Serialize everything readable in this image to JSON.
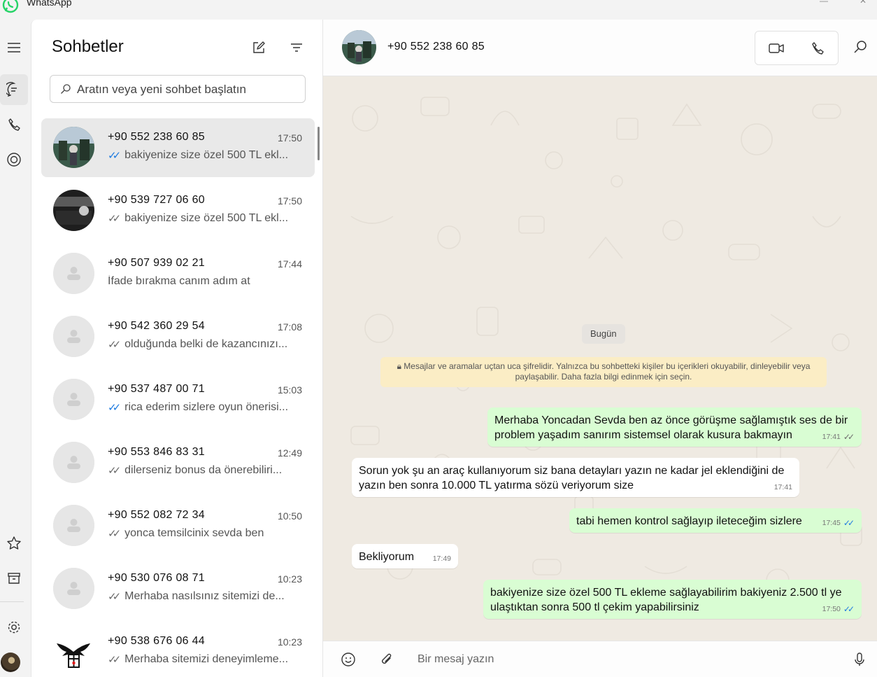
{
  "window": {
    "title": "WhatsApp"
  },
  "rail": {
    "items": [
      {
        "icon": "menu-icon"
      },
      {
        "icon": "chats-icon",
        "active": true
      },
      {
        "icon": "calls-icon"
      },
      {
        "icon": "status-icon"
      },
      {
        "icon": "star-icon"
      },
      {
        "icon": "archive-icon"
      },
      {
        "icon": "settings-icon"
      }
    ]
  },
  "chat_list": {
    "title": "Sohbetler",
    "search_placeholder": "Aratın veya yeni sohbet başlatın",
    "chats": [
      {
        "name": "+90 552 238 60 85",
        "time": "17:50",
        "tick": "read",
        "preview": "bakiyenize size özel  500 TL ekl...",
        "avatar": "photo-1",
        "selected": true
      },
      {
        "name": "+90 539 727 06 60",
        "time": "17:50",
        "tick": "sent",
        "preview": "bakiyenize size özel  500 TL ekl...",
        "avatar": "photo-2"
      },
      {
        "name": "+90 507 939 02 21",
        "time": "17:44",
        "tick": "none",
        "preview": "İfade bırakma canım adım at",
        "avatar": "default"
      },
      {
        "name": "+90 542 360 29 54",
        "time": "17:08",
        "tick": "sent",
        "preview": "olduğunda belki de kazancınızı...",
        "avatar": "default"
      },
      {
        "name": "+90 537 487 00 71",
        "time": "15:03",
        "tick": "read",
        "preview": "rica ederim sizlere oyun önerisi...",
        "avatar": "default"
      },
      {
        "name": "+90 553 846 83 31",
        "time": "12:49",
        "tick": "sent",
        "preview": "dilerseniz bonus da önerebiliri...",
        "avatar": "default"
      },
      {
        "name": "+90 552 082 72 34",
        "time": "10:50",
        "tick": "sent",
        "preview": "yonca temsilcinix sevda ben",
        "avatar": "default"
      },
      {
        "name": "+90 530 076 08 71",
        "time": "10:23",
        "tick": "sent",
        "preview": "Merhaba nasılsınız  sitemizi de...",
        "avatar": "default"
      },
      {
        "name": "+90 538 676 06 44",
        "time": "10:23",
        "tick": "sent",
        "preview": "Merhaba sitemizi deneyimleme...",
        "avatar": "eagle-logo"
      }
    ]
  },
  "conversation": {
    "contact": "+90 552 238 60 85",
    "date_chip": "Bugün",
    "encryption_note": "Mesajlar ve aramalar uçtan uca şifrelidir. Yalnızca bu sohbetteki kişiler bu içerikleri okuyabilir, dinleyebilir veya paylaşabilir. Daha fazla bilgi edinmek için seçin.",
    "messages": [
      {
        "dir": "out",
        "text": "Merhaba Yoncadan Sevda ben az önce görüşme sağlamıştık ses de bir problem yaşadım sanırım sistemsel olarak kusura bakmayın",
        "time": "17:41",
        "tick": "sent"
      },
      {
        "dir": "in",
        "text": "Sorun yok şu an araç kullanıyorum siz bana detayları yazın ne kadar jel eklendiğini de yazın ben sonra 10.000 TL yatırma sözü veriyorum size",
        "time": "17:41"
      },
      {
        "dir": "out",
        "text": "tabi hemen kontrol sağlayıp ileteceğim sizlere",
        "time": "17:45",
        "tick": "read"
      },
      {
        "dir": "in",
        "text": "Bekliyorum",
        "time": "17:49"
      },
      {
        "dir": "out",
        "text": "bakiyenize size özel  500 TL ekleme sağlayabilirim  bakiyeniz 2.500 tl ye ulaştıktan sonra  500 tl çekim yapabilirsiniz",
        "time": "17:50",
        "tick": "read"
      }
    ],
    "composer_placeholder": "Bir mesaj yazın"
  }
}
